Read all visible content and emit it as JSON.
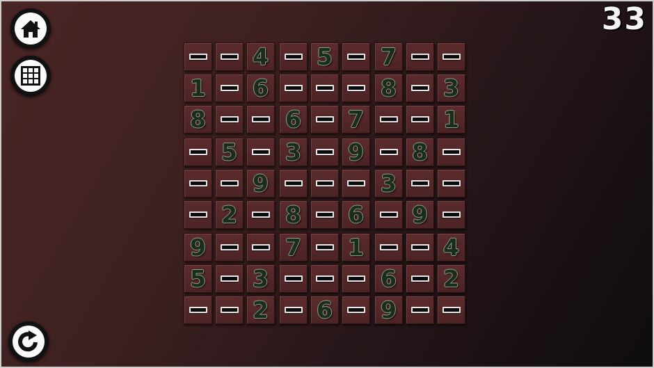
{
  "score": "33",
  "buttons": {
    "home_icon": "home-icon",
    "grid_icon": "grid-icon",
    "redo_icon": "redo-icon"
  },
  "board": [
    [
      "",
      "",
      "4",
      "",
      "5",
      "",
      "7",
      "",
      ""
    ],
    [
      "1",
      "",
      "6",
      "",
      "",
      "",
      "8",
      "",
      "3"
    ],
    [
      "8",
      "",
      "",
      "6",
      "",
      "7",
      "",
      "",
      "1"
    ],
    [
      "",
      "5",
      "",
      "3",
      "",
      "9",
      "",
      "8",
      ""
    ],
    [
      "",
      "",
      "9",
      "",
      "",
      "",
      "3",
      "",
      ""
    ],
    [
      "",
      "2",
      "",
      "8",
      "",
      "6",
      "",
      "9",
      ""
    ],
    [
      "9",
      "",
      "",
      "7",
      "",
      "1",
      "",
      "",
      "4"
    ],
    [
      "5",
      "",
      "3",
      "",
      "",
      "",
      "6",
      "",
      "2"
    ],
    [
      "",
      "",
      "2",
      "",
      "6",
      "",
      "9",
      "",
      ""
    ]
  ],
  "colors": {
    "digit_fill": "#1a2c1c",
    "digit_outline": "#8aa08c",
    "cell": "#5c2b2d"
  }
}
